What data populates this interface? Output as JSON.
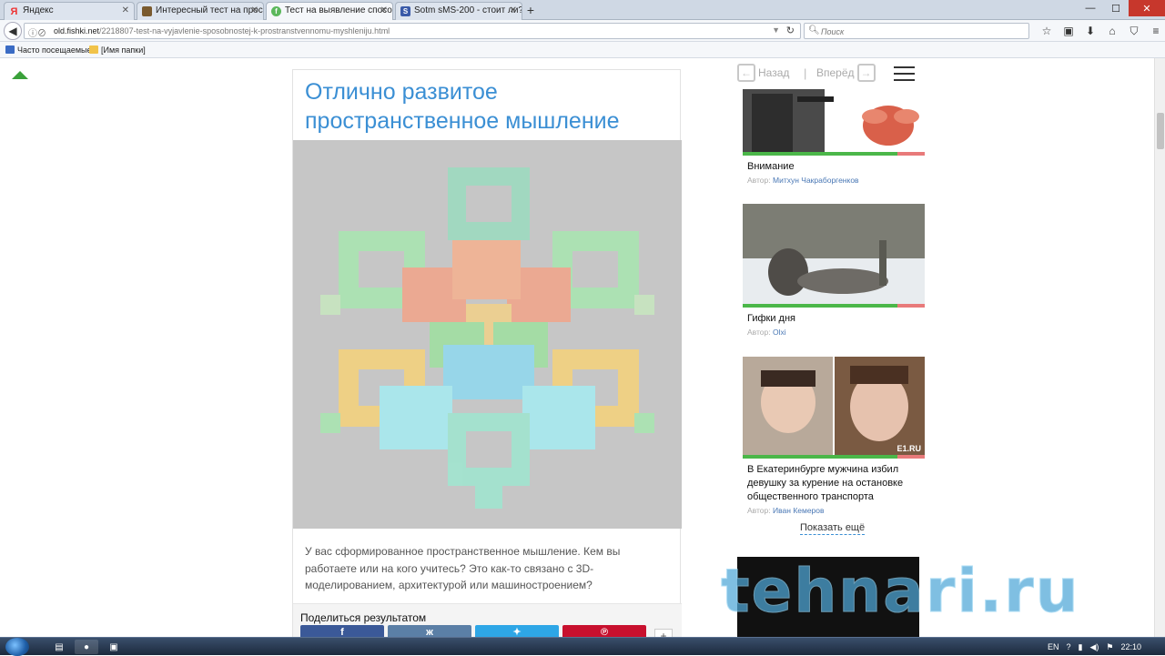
{
  "browser": {
    "tabs": [
      {
        "label": "Яндекс",
        "active": false,
        "favicon": "yandex-icon",
        "color": "#e33"
      },
      {
        "label": "Интересный тест на прос...",
        "active": false,
        "favicon": "site-icon",
        "color": "#7a5a2e"
      },
      {
        "label": "Тест на выявление спосо...",
        "active": true,
        "favicon": "fishki-icon",
        "color": "#5cb85c"
      },
      {
        "label": "Sotm sMS-200 - стоит ли?",
        "active": false,
        "favicon": "sotm-icon",
        "color": "#3a5aa8"
      }
    ],
    "new_tab_label": "+",
    "url_domain": "old.fishki.net",
    "url_path": "/2218807-test-na-vyjavlenie-sposobnostej-k-prostranstvennomu-myshleniju.html",
    "search_placeholder": "Поиск",
    "bookmarks": [
      {
        "label": "Часто посещаемые",
        "icon": "bookmark-icon"
      },
      {
        "label": "[Имя папки]",
        "icon": "folder-icon"
      }
    ]
  },
  "article": {
    "title": "Отлично развитое пространственное мышление",
    "description": "У вас сформированное пространственное мышление. Кем вы работаете или на кого учитесь? Это как-то связано с 3D-моделированием, архитектурой или машиностроением?",
    "share_title": "Поделиться результатом",
    "share_buttons": [
      {
        "name": "facebook",
        "label": "f",
        "color": "#3b5998"
      },
      {
        "name": "vk",
        "label": "ж",
        "color": "#5b7fa6"
      },
      {
        "name": "twitter",
        "label": "✦",
        "color": "#2ea6e6"
      },
      {
        "name": "pinterest",
        "label": "℗",
        "color": "#c8102e"
      }
    ],
    "share_more_label": "+"
  },
  "sidebar": {
    "nav": {
      "back_label": "Назад",
      "forward_label": "Вперёд",
      "separator": "|"
    },
    "items": [
      {
        "title": "Внимание",
        "author_prefix": "Автор:",
        "author": "Митхун Чакраборгенков"
      },
      {
        "title": "Гифки дня",
        "author_prefix": "Автор:",
        "author": "Olxi"
      },
      {
        "title": "В Екатеринбурге мужчина избил девушку за курение на остановке общественного транспорта",
        "author_prefix": "Автор:",
        "author": "Иван Кемеров"
      }
    ],
    "thumb_watermark_3": "E1.RU",
    "show_more": "Показать ещё"
  },
  "watermark": "tehnari.ru",
  "taskbar": {
    "lang": "EN",
    "time": "22:10"
  },
  "colors": {
    "accent": "#3b8fd4",
    "green": "#3aa13a"
  }
}
